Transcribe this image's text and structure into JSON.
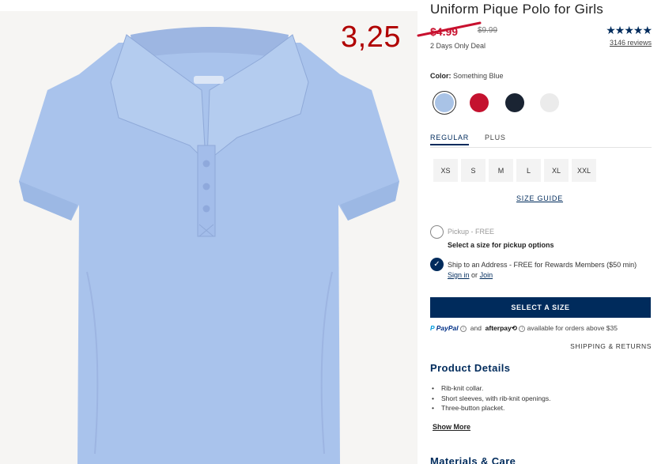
{
  "product": {
    "title": "Uniform Pique Polo for Girls",
    "sale_price": "$4.99",
    "original_price": "$9.99",
    "deal": "2 Days Only Deal",
    "stars": "★★★★★",
    "reviews": "3146 reviews"
  },
  "overlay": {
    "price_annotation": "3,25"
  },
  "color": {
    "label": "Color:",
    "selected": "Something Blue",
    "swatches": [
      {
        "name": "Something Blue",
        "hex": "#a9c3e6"
      },
      {
        "name": "Red",
        "hex": "#c4122f"
      },
      {
        "name": "Navy",
        "hex": "#1a2433"
      },
      {
        "name": "White",
        "hex": "#ebebeb"
      }
    ]
  },
  "fit_tabs": [
    "REGULAR",
    "PLUS"
  ],
  "sizes": [
    "XS",
    "S",
    "M",
    "L",
    "XL",
    "XXL"
  ],
  "size_guide": "SIZE GUIDE",
  "fulfillment": {
    "pickup": "Pickup - FREE",
    "pickup_sub": "Select a size for pickup options",
    "ship_text": "Ship to an Address - FREE for Rewards Members ($50 min)",
    "sign_in": "Sign in",
    "or": "or",
    "join": "Join"
  },
  "cta": "SELECT A SIZE",
  "payment": {
    "paypal": "PayPal",
    "and": "and",
    "afterpay": "afterpay",
    "afterpay_mark": "⟲",
    "info_icon": "i",
    "note": "available for orders above $35"
  },
  "shipping_returns": "SHIPPING & RETURNS",
  "product_details": {
    "heading": "Product Details",
    "items": [
      "Rib-knit collar.",
      "Short sleeves, with rib-knit openings.",
      "Three-button placket."
    ],
    "show_more": "Show More"
  },
  "materials_heading": "Materials & Care",
  "colors": {
    "navy": "#002b5c",
    "sale_red": "#c8102e",
    "overlay_red": "#b00000"
  }
}
